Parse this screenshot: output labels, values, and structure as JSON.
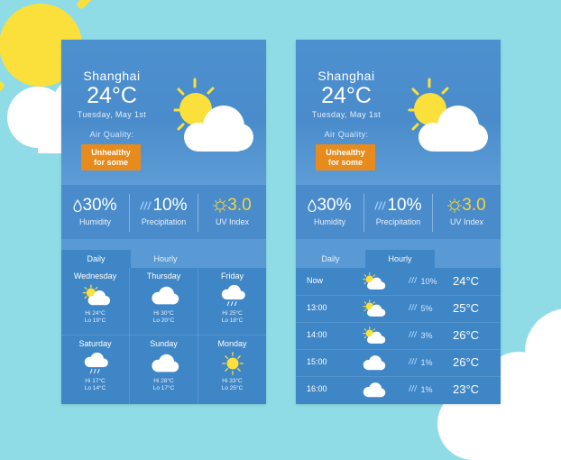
{
  "colors": {
    "background": "#8fdce6",
    "card": "#3f86c6",
    "badge": "#e88b1d",
    "uv": "#f4d43a",
    "sun": "#fbe03b"
  },
  "daily_card": {
    "city": "Shanghai",
    "temperature": "24°C",
    "date": "Tuesday, May 1st",
    "air_quality_label": "Air Quality:",
    "air_quality_line1": "Unhealthy",
    "air_quality_line2": "for some",
    "stats": [
      {
        "icon": "droplet-icon",
        "value": "30%",
        "label": "Humidity"
      },
      {
        "icon": "rain-streaks-icon",
        "value": "10%",
        "label": "Precipitation"
      },
      {
        "icon": "uv-sun-icon",
        "value": "3.0",
        "label": "UV Index"
      }
    ],
    "tabs": [
      "Daily",
      "Hourly"
    ],
    "active_tab": "Daily",
    "days": [
      {
        "day": "Wednesday",
        "icon": "partly-cloudy-icon",
        "hi": "Hi 24°C",
        "lo": "Lo 19°C"
      },
      {
        "day": "Thursday",
        "icon": "cloudy-icon",
        "hi": "Hi 30°C",
        "lo": "Lo 20°C"
      },
      {
        "day": "Friday",
        "icon": "rain-cloud-icon",
        "hi": "Hi 25°C",
        "lo": "Lo 18°C"
      },
      {
        "day": "Saturday",
        "icon": "rain-cloud-icon",
        "hi": "Hi 17°C",
        "lo": "Lo 14°C"
      },
      {
        "day": "Sunday",
        "icon": "cloudy-icon",
        "hi": "Hi 28°C",
        "lo": "Lo 17°C"
      },
      {
        "day": "Monday",
        "icon": "sunny-icon",
        "hi": "Hi 33°C",
        "lo": "Lo 25°C"
      }
    ]
  },
  "hourly_card": {
    "city": "Shanghai",
    "temperature": "24°C",
    "date": "Tuesday, May 1st",
    "air_quality_label": "Air Quality:",
    "air_quality_line1": "Unhealthy",
    "air_quality_line2": "for some",
    "stats": [
      {
        "icon": "droplet-icon",
        "value": "30%",
        "label": "Humidity"
      },
      {
        "icon": "rain-streaks-icon",
        "value": "10%",
        "label": "Precipitation"
      },
      {
        "icon": "uv-sun-icon",
        "value": "3.0",
        "label": "UV Index"
      }
    ],
    "tabs": [
      "Daily",
      "Hourly"
    ],
    "active_tab": "Hourly",
    "hours": [
      {
        "time": "Now",
        "icon": "partly-cloudy-icon",
        "precip": "10%",
        "temp": "24°C"
      },
      {
        "time": "13:00",
        "icon": "partly-cloudy-icon",
        "precip": "5%",
        "temp": "25°C"
      },
      {
        "time": "14:00",
        "icon": "partly-cloudy-icon",
        "precip": "3%",
        "temp": "26°C"
      },
      {
        "time": "15:00",
        "icon": "cloudy-icon",
        "precip": "1%",
        "temp": "26°C"
      },
      {
        "time": "16:00",
        "icon": "cloudy-icon",
        "precip": "1%",
        "temp": "23°C"
      }
    ]
  }
}
